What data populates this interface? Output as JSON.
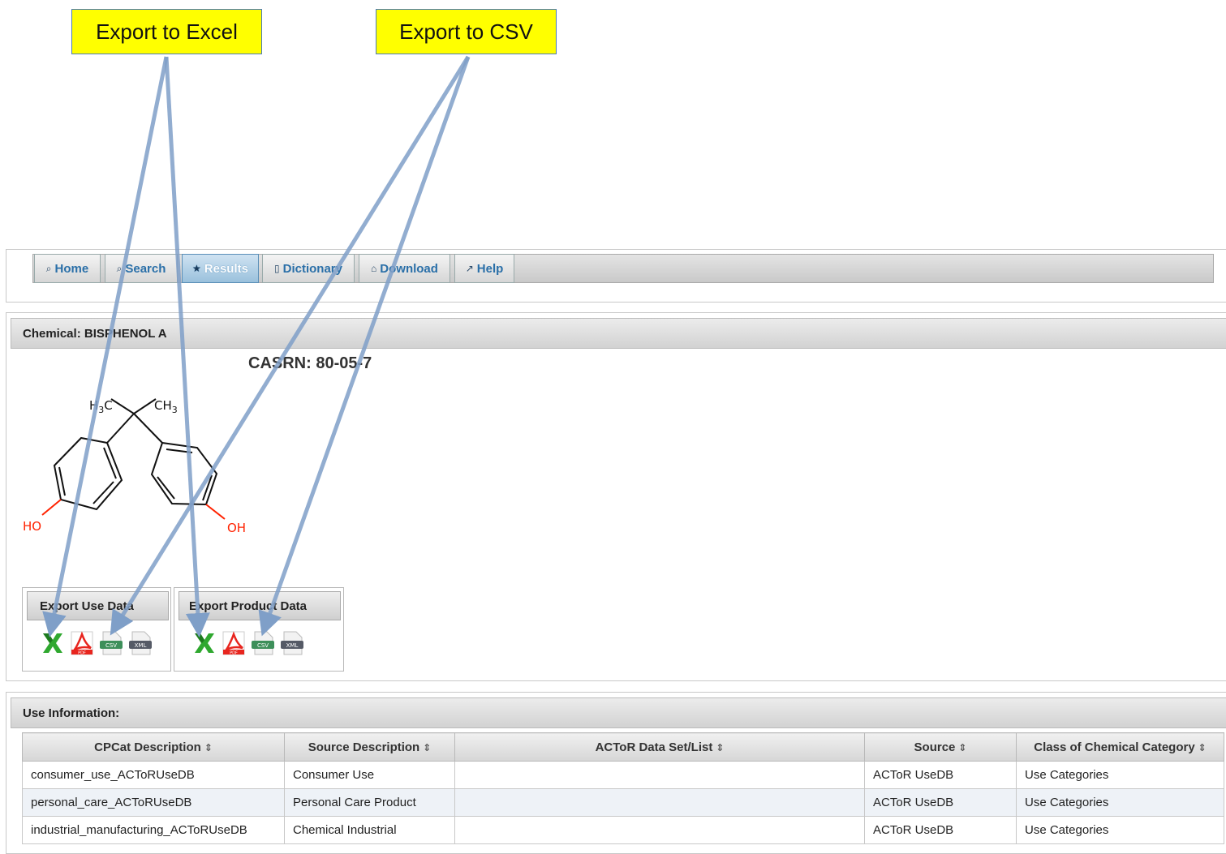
{
  "callouts": {
    "excel": "Export to Excel",
    "csv": "Export to CSV"
  },
  "nav": {
    "tabs": [
      {
        "label": "Home",
        "icon": "search-icon"
      },
      {
        "label": "Search",
        "icon": "search-icon"
      },
      {
        "label": "Results",
        "icon": "star-icon",
        "active": true
      },
      {
        "label": "Dictionary",
        "icon": "document-icon"
      },
      {
        "label": "Download",
        "icon": "home-icon"
      },
      {
        "label": "Help",
        "icon": "wrench-icon"
      }
    ]
  },
  "chemical": {
    "header": "Chemical: BISPHENOL A",
    "casrn": "CASRN: 80-05-7",
    "structure_labels": {
      "h3c": "H3C",
      "ch3": "CH3",
      "ho_left": "HO",
      "oh_right": "OH"
    }
  },
  "exports": {
    "use": {
      "label": "Export Use Data"
    },
    "product": {
      "label": "Export Product Data"
    },
    "icons": {
      "excel": "excel-icon",
      "pdf": "pdf-icon",
      "csv": "CSV",
      "xml": "XML",
      "pdf_text": "PDF"
    }
  },
  "use_info": {
    "header": "Use Information:",
    "columns": [
      "CPCat Description",
      "Source Description",
      "ACToR Data Set/List",
      "Source",
      "Class of Chemical Category"
    ],
    "rows": [
      [
        "consumer_use_ACToRUseDB",
        "Consumer Use",
        "",
        "ACToR UseDB",
        "Use Categories"
      ],
      [
        "personal_care_ACToRUseDB",
        "Personal Care Product",
        "",
        "ACToR UseDB",
        "Use Categories"
      ],
      [
        "industrial_manufacturing_ACToRUseDB",
        "Chemical Industrial",
        "",
        "ACToR UseDB",
        "Use Categories"
      ]
    ]
  },
  "colors": {
    "callout_bg": "#ffff00",
    "arrow": "#7f9fc8",
    "link": "#2a6fa8",
    "hydroxyl": "#ff2200"
  }
}
